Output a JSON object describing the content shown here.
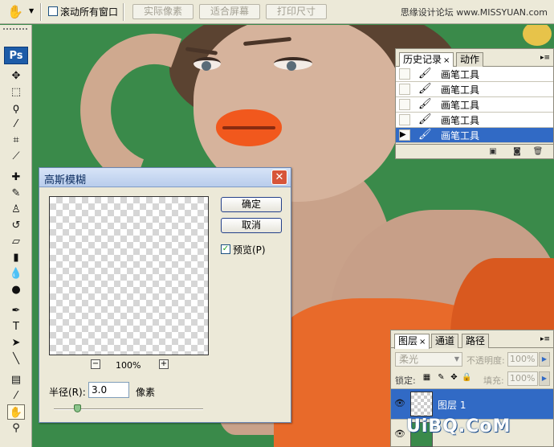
{
  "options_bar": {
    "tool_icon": "hand-tool-icon",
    "scroll_all_windows_label": "滚动所有窗口",
    "scroll_all_windows_checked": false,
    "buttons": [
      "实际像素",
      "适合屏幕",
      "打印尺寸"
    ],
    "site_brand": "思缘设计论坛 www.MISSYUAN.com"
  },
  "toolbox": {
    "logo": "Ps",
    "tools": [
      "move-tool-icon",
      "marquee-tool-icon",
      "lasso-tool-icon",
      "magic-wand-icon",
      "crop-tool-icon",
      "slice-tool-icon",
      "healing-brush-icon",
      "brush-tool-icon",
      "clone-stamp-icon",
      "history-brush-icon",
      "eraser-tool-icon",
      "gradient-tool-icon",
      "blur-tool-icon",
      "dodge-tool-icon",
      "pen-tool-icon",
      "type-tool-icon",
      "path-selection-icon",
      "line-tool-icon",
      "notes-tool-icon",
      "eyedropper-tool-icon",
      "hand-tool-icon",
      "zoom-tool-icon"
    ],
    "active_tool": "hand-tool-icon"
  },
  "history_panel": {
    "tabs": [
      "历史记录",
      "动作"
    ],
    "tab_close": "×",
    "items": [
      "画笔工具",
      "画笔工具",
      "画笔工具",
      "画笔工具",
      "画笔工具"
    ],
    "selected_index": 4,
    "footer_icons": [
      "new-snapshot-icon",
      "create-document-icon",
      "trash-icon"
    ]
  },
  "layers_panel": {
    "tabs": [
      "图层",
      "通道",
      "路径"
    ],
    "tab_close": "×",
    "blend_mode": "柔光",
    "opacity_label": "不透明度:",
    "opacity_value": "100%",
    "lock_label": "锁定:",
    "fill_label": "填充:",
    "fill_value": "100%",
    "layers": [
      {
        "name": "图层 1",
        "selected": true
      },
      {
        "name": "",
        "selected": false
      }
    ]
  },
  "gaussian_blur_dialog": {
    "title": "高斯模糊",
    "ok_label": "确定",
    "cancel_label": "取消",
    "preview_label": "预览(P)",
    "preview_checked": true,
    "zoom_out": "−",
    "zoom_in": "+",
    "zoom_level": "100%",
    "radius_label": "半径(R):",
    "radius_value": "3.0",
    "radius_unit": "像素"
  },
  "watermark": "UiBQ.CoM"
}
